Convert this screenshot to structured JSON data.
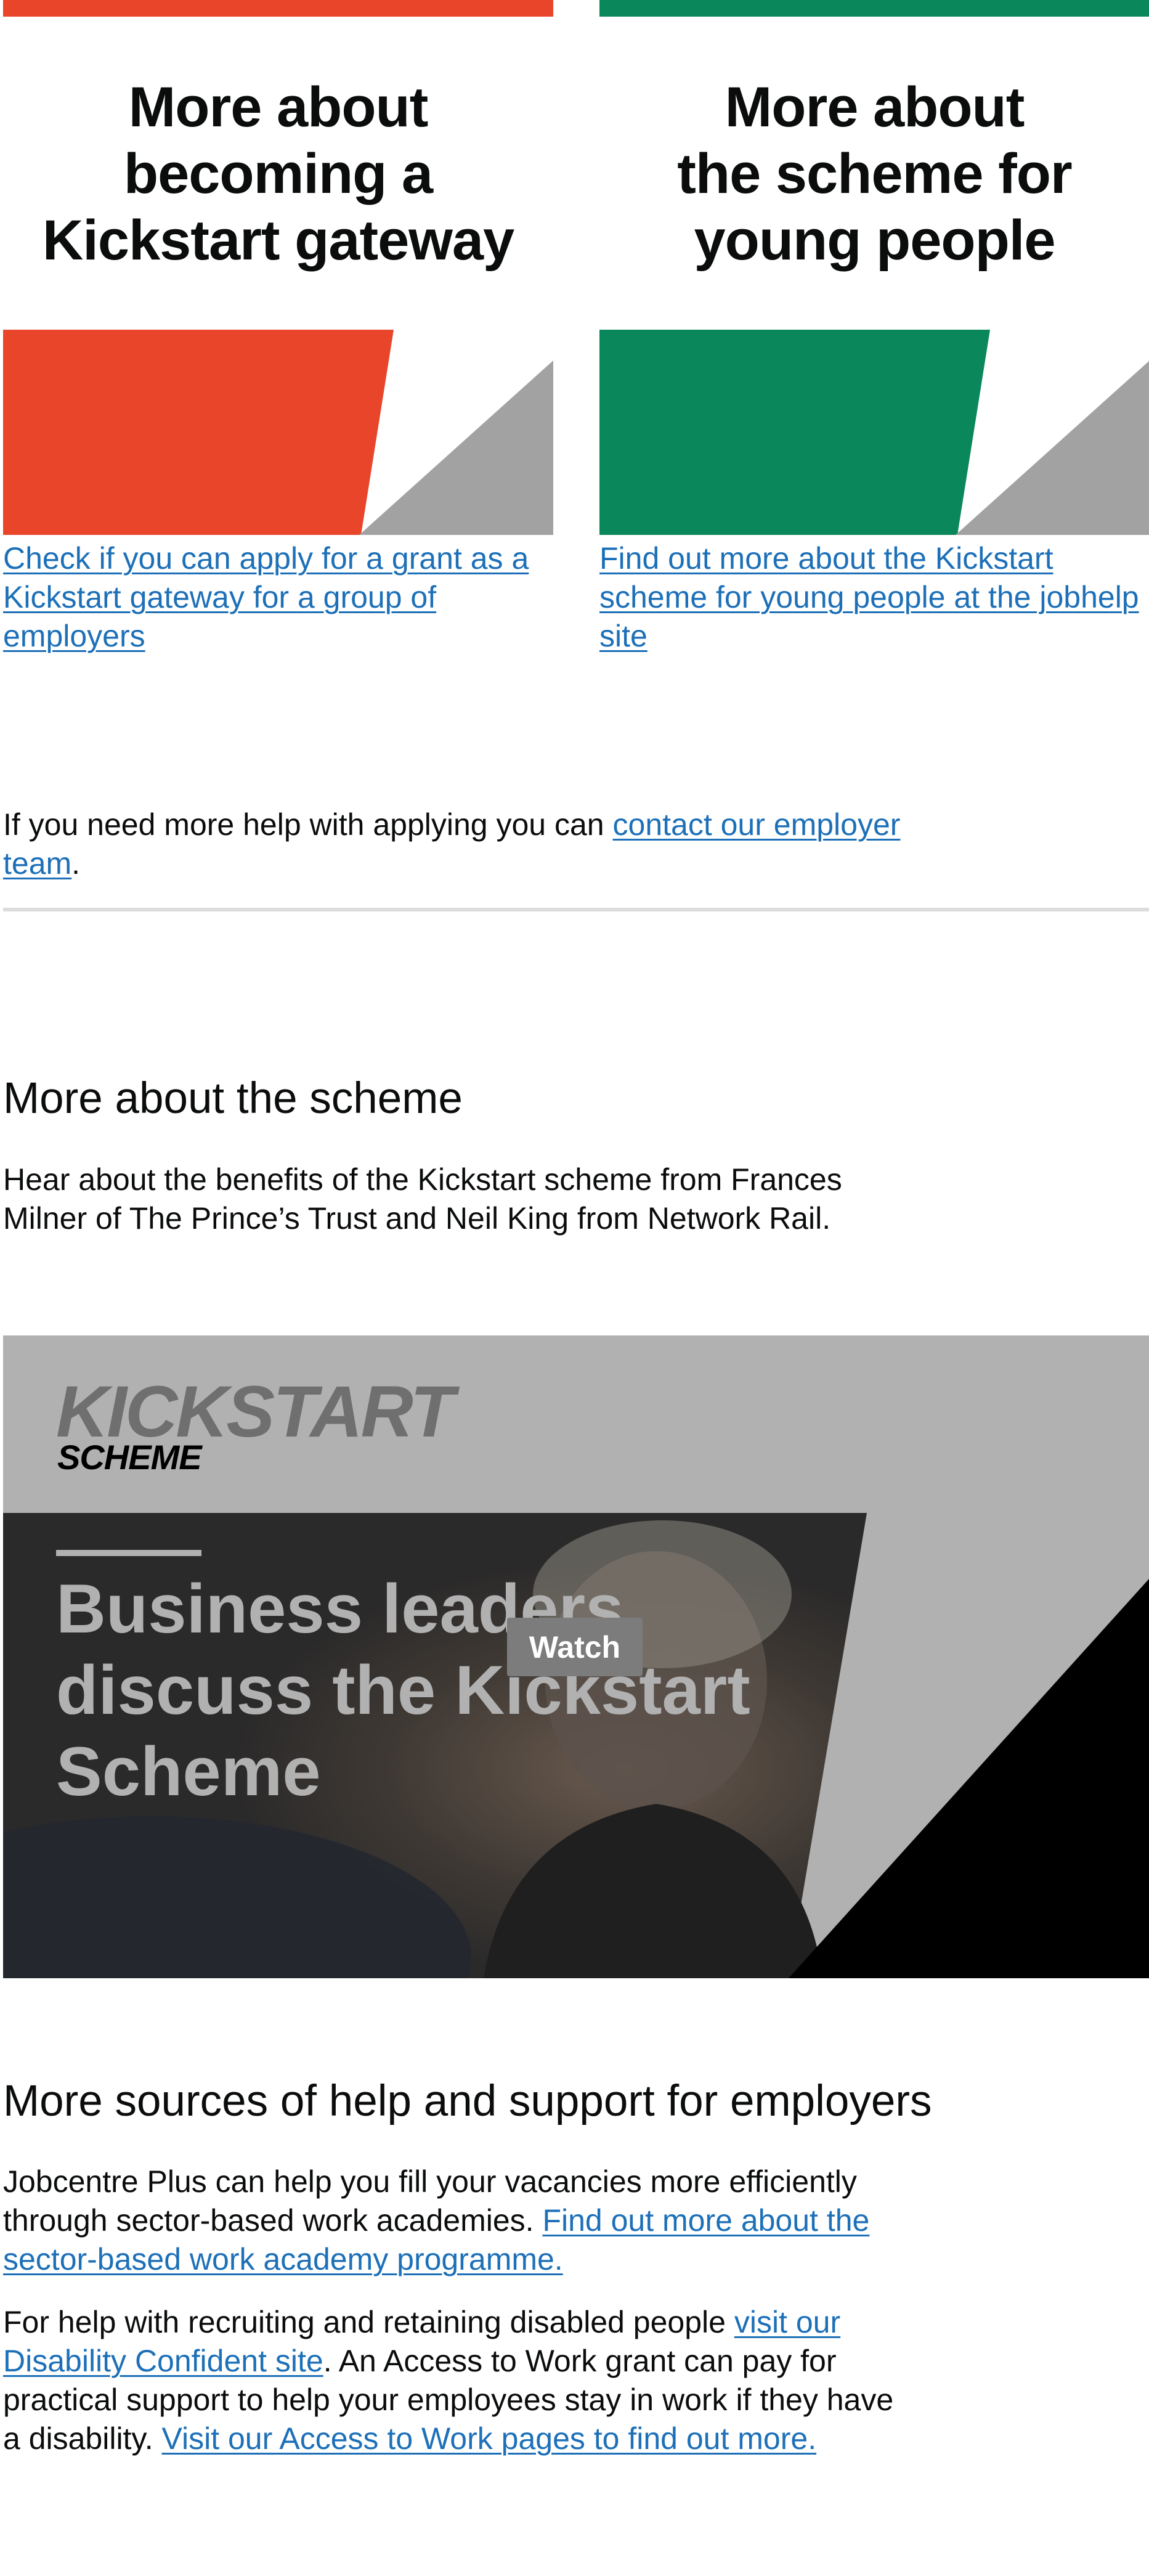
{
  "cards": [
    {
      "title_lines": [
        "More about",
        "becoming a",
        "Kickstart gateway"
      ],
      "link_text": "Check if you can apply for a grant as a Kickstart gateway for a group of employers",
      "accent": "#e8452a"
    },
    {
      "title_lines": [
        "More about",
        "the scheme for",
        "young people"
      ],
      "link_text": "Find out more about the Kickstart scheme for young people at the jobhelp site",
      "accent": "#0a875b"
    }
  ],
  "help": {
    "prefix": "If you need more help with applying you can ",
    "link_text": "contact our employer team",
    "suffix": "."
  },
  "scheme_section": {
    "heading": "More about the scheme",
    "text": "Hear about the benefits of the Kickstart scheme from Frances Milner of The Prince’s Trust and Neil King from Network Rail."
  },
  "video": {
    "logo_main": "KICKSTART",
    "logo_sub": "SCHEME",
    "headline_lines": [
      "Business leaders",
      "discuss the Kickstart",
      "Scheme"
    ],
    "watch_label": "Watch"
  },
  "support_section": {
    "heading": "More sources of help and support for employers",
    "para1_text": "Jobcentre Plus can help you fill your vacancies more efficiently through sector-based work academies. ",
    "para1_link": "Find out more about the sector-based work academy programme.",
    "para2_prefix": "For help with recruiting and retaining disabled people ",
    "para2_link1": "visit our Disability Confident site",
    "para2_middle": ". An Access to Work grant can pay for practical support to help your employees stay in work if they have a disability. ",
    "para2_link2": "Visit our Access to Work pages to find out more."
  },
  "colors": {
    "link": "#1d70b8",
    "grey_shape": "#a2a2a2",
    "divider": "#dcdcdc",
    "video_bg": "#b1b1b1"
  }
}
